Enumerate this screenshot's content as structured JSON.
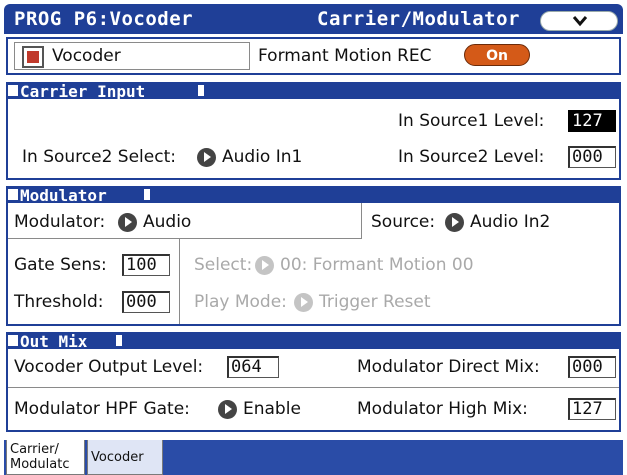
{
  "title": {
    "left": "PROG P6:Vocoder",
    "right": "Carrier/Modulator"
  },
  "top_row": {
    "vocoder_label": "Vocoder",
    "vocoder_checked": true,
    "formant_label": "Formant Motion REC",
    "formant_button": "On"
  },
  "carrier": {
    "header": "Carrier Input",
    "src1_level_label": "In Source1 Level:",
    "src1_level_value": "127",
    "src2_select_label": "In Source2 Select:",
    "src2_select_value": "Audio In1",
    "src2_level_label": "In Source2 Level:",
    "src2_level_value": "000"
  },
  "modulator": {
    "header": "Modulator",
    "modulator_label": "Modulator:",
    "modulator_value": "Audio",
    "source_label": "Source:",
    "source_value": "Audio In2",
    "gate_label": "Gate Sens:",
    "gate_value": "100",
    "threshold_label": "Threshold:",
    "threshold_value": "000",
    "select_label": "Select:",
    "select_value": "00: Formant Motion 00",
    "playmode_label": "Play Mode:",
    "playmode_value": "Trigger Reset"
  },
  "outmix": {
    "header": "Out Mix",
    "output_label": "Vocoder Output Level:",
    "output_value": "064",
    "direct_label": "Modulator Direct Mix:",
    "direct_value": "000",
    "hpf_label": "Modulator HPF Gate:",
    "hpf_value": "Enable",
    "high_label": "Modulator High Mix:",
    "high_value": "127"
  },
  "tabs": [
    {
      "line1": "Carrier/",
      "line2": "Modulatc"
    },
    {
      "line1": "Vocoder",
      "line2": ""
    }
  ],
  "colors": {
    "title_blue": "#1f3f97",
    "accent_orange": "#d45a18",
    "check_red": "#c0392b"
  }
}
